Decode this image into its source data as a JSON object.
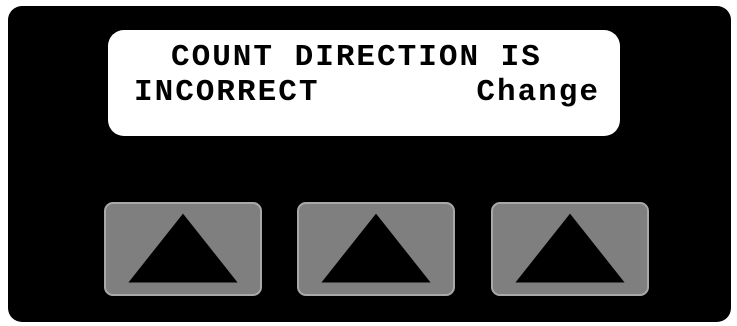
{
  "display": {
    "line1": "COUNT DIRECTION IS",
    "line2_left": "INCORRECT",
    "line2_right": "Change"
  },
  "buttons": [
    {
      "icon": "up-arrow-icon"
    },
    {
      "icon": "up-arrow-icon"
    },
    {
      "icon": "up-arrow-icon"
    }
  ],
  "colors": {
    "panel": "#000000",
    "screen": "#ffffff",
    "key_face": "#7f7f7f",
    "key_border": "#a8a8a8",
    "arrow": "#000000"
  }
}
